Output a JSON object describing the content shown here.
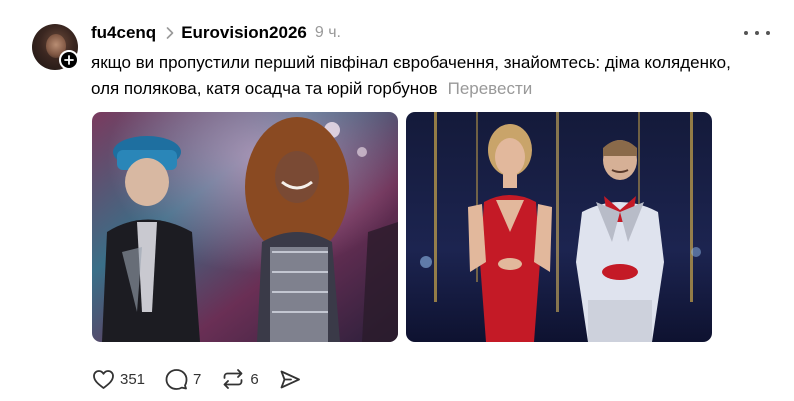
{
  "post": {
    "username": "fu4cenq",
    "community": "Eurovision2026",
    "time": "9 ч.",
    "text": "якщо ви пропустили перший півфінал євробачення, знайомтесь: діма коляденко, оля полякова, катя осадча та юрій горбунов",
    "translate_label": "Перевести",
    "media": [
      "performer-photo",
      "hosts-photo"
    ]
  },
  "actions": {
    "likes": "351",
    "replies": "7",
    "reposts": "6"
  },
  "icons": [
    "plus-icon",
    "chevron-right-icon",
    "more-icon",
    "heart-icon",
    "comment-icon",
    "repost-icon",
    "share-icon"
  ]
}
